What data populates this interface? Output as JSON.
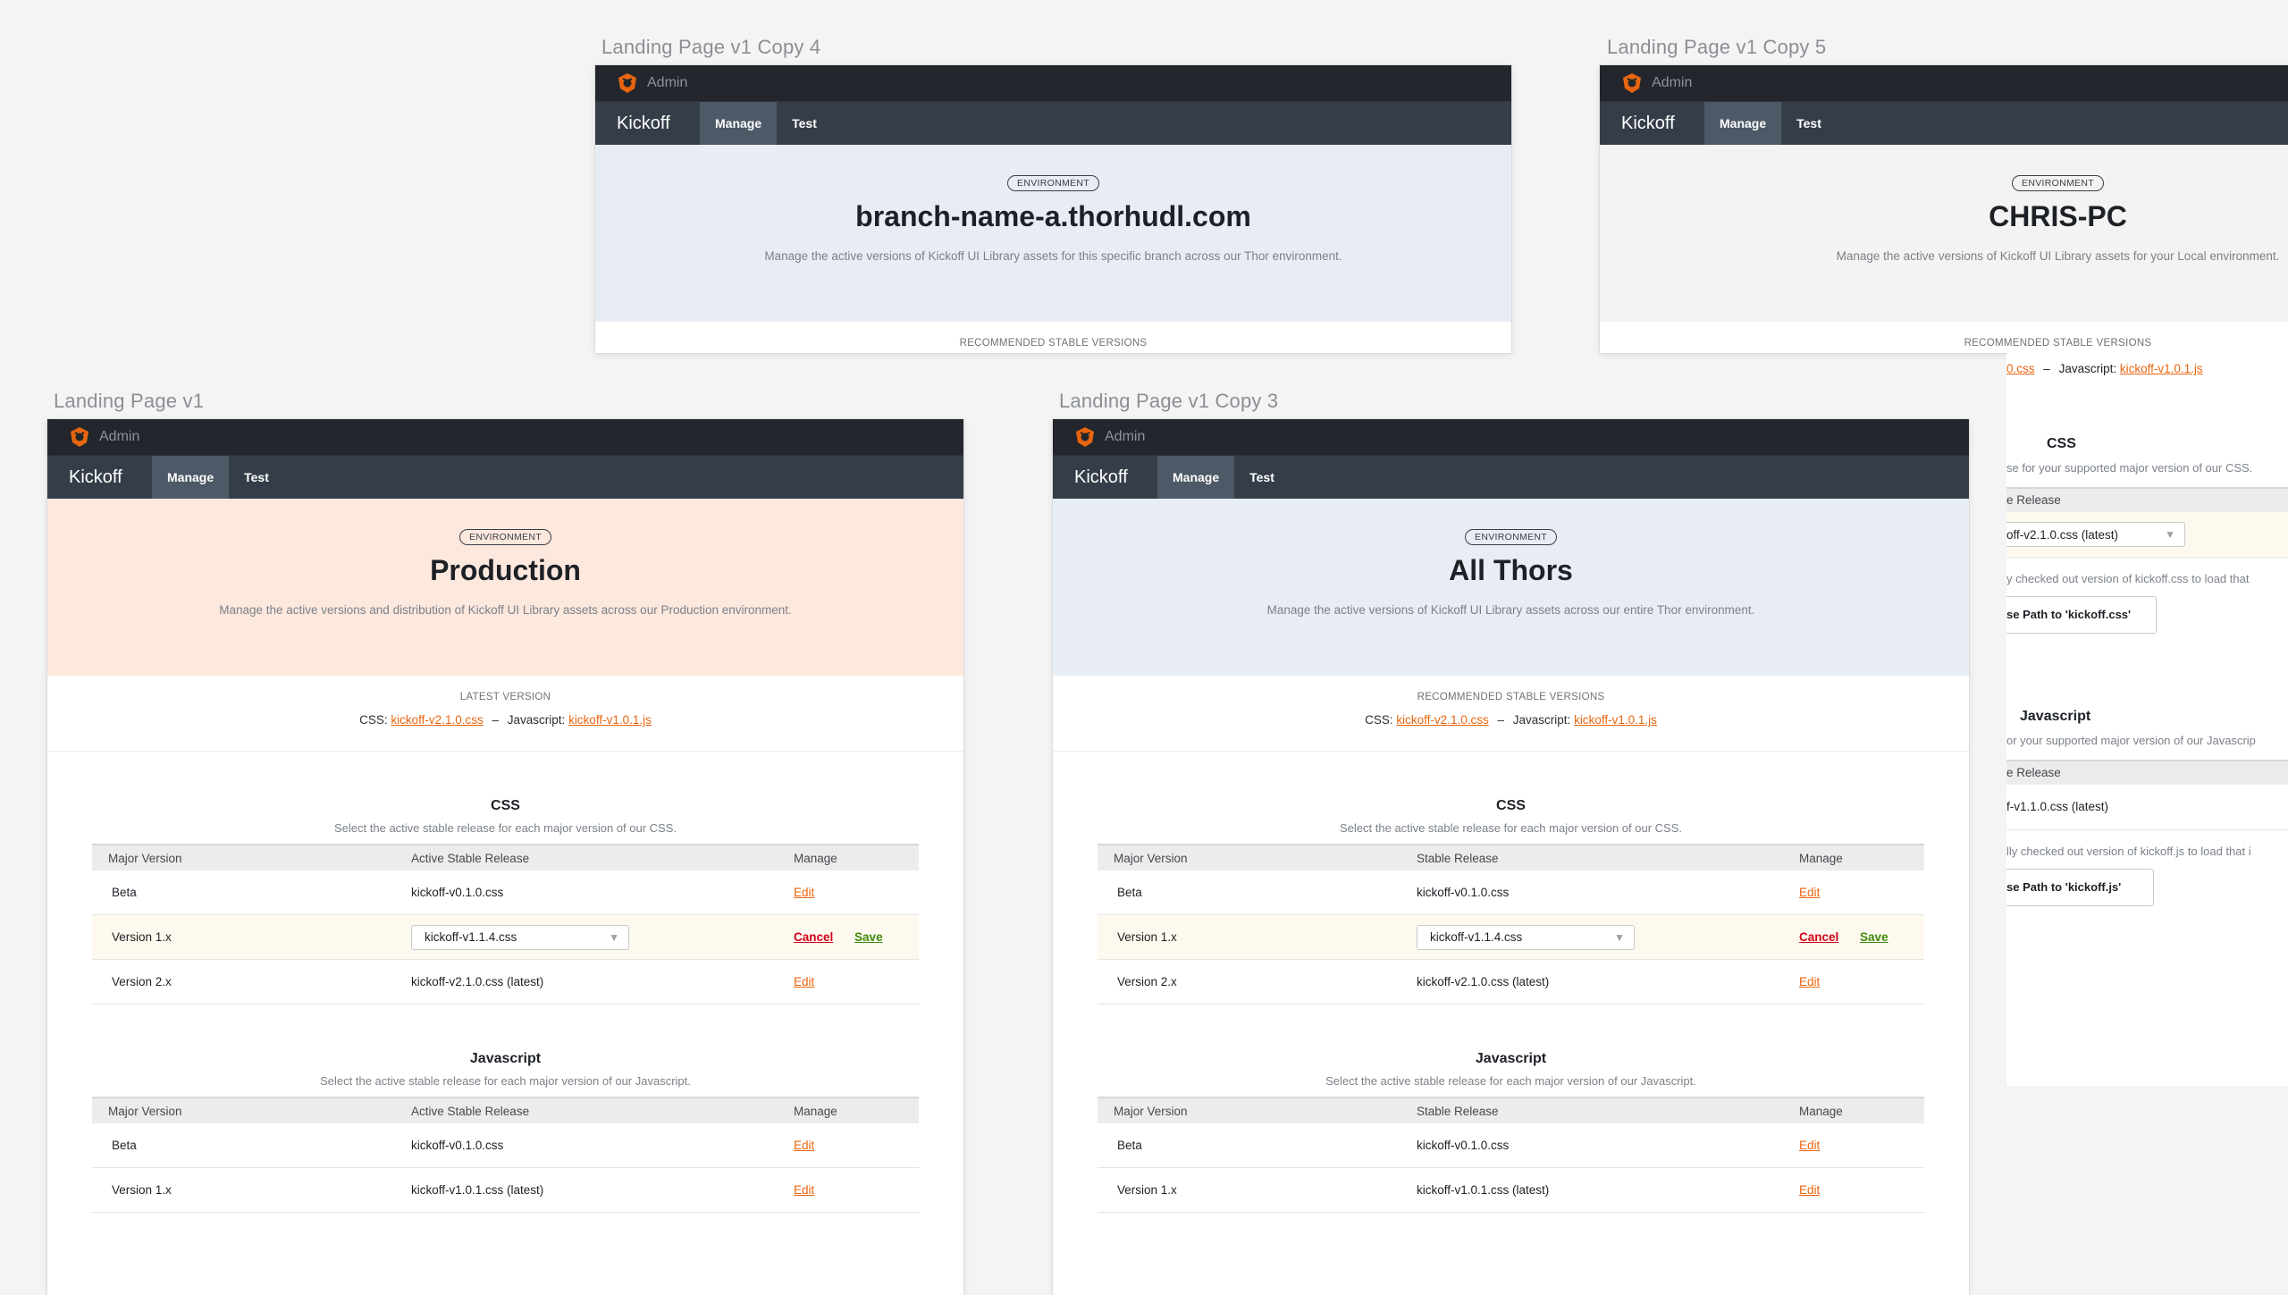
{
  "labels": {
    "copy4": "Landing Page v1 Copy 4",
    "copy5": "Landing Page v1 Copy 5",
    "v1": "Landing Page v1",
    "copy3": "Landing Page v1 Copy 3"
  },
  "common": {
    "admin": "Admin",
    "brand": "Kickoff",
    "tab_manage": "Manage",
    "tab_test": "Test",
    "env_badge": "ENVIRONMENT",
    "css_label": "CSS:",
    "js_label": "Javascript:",
    "dash": "–",
    "css_link": "kickoff-v2.1.0.css",
    "js_link": "kickoff-v1.0.1.js",
    "edit": "Edit",
    "cancel": "Cancel",
    "save": "Save"
  },
  "copy4": {
    "title": "branch-name-a.thorhudl.com",
    "sub": "Manage the active versions of Kickoff UI Library assets for this specific branch across our Thor environment.",
    "versions_title": "RECOMMENDED STABLE VERSIONS"
  },
  "copy5": {
    "title": "CHRIS-PC",
    "sub": "Manage the active versions of Kickoff UI Library assets for your Local environment.",
    "versions_title": "RECOMMENDED STABLE VERSIONS",
    "versions_css_partial": "0.css",
    "css_title": "CSS",
    "css_sub": "se for your supported major version of our CSS.",
    "css_col": "e Release",
    "css_select": "off-v2.1.0.css (latest)",
    "css_note": "y checked out version of kickoff.css to load that",
    "css_button": "se Path to 'kickoff.css'",
    "js_title": "Javascript",
    "js_sub": "or your supported major version of our Javascrip",
    "js_col": "e Release",
    "js_value": "f-v1.1.0.css (latest)",
    "js_note": "lly checked out version of kickoff.js to load that i",
    "js_button": "se Path to 'kickoff.js'"
  },
  "v1": {
    "title": "Production",
    "sub": "Manage the active versions and distribution of Kickoff UI Library assets across our Production environment.",
    "versions_title": "LATEST VERSION",
    "col1": "Major Version",
    "col2": "Active Stable Release",
    "col3": "Manage"
  },
  "copy3": {
    "title": "All Thors",
    "sub": "Manage the active versions of Kickoff UI Library assets across our entire Thor environment.",
    "versions_title": "RECOMMENDED STABLE VERSIONS",
    "col1": "Major Version",
    "col2": "Stable Release",
    "col3": "Manage"
  },
  "css_section": {
    "title": "CSS",
    "sub": "Select the active stable release for each major version of our CSS.",
    "rows": [
      {
        "version": "Beta",
        "release": "kickoff-v0.1.0.css"
      },
      {
        "version": "Version 1.x",
        "release": "kickoff-v1.1.4.css"
      },
      {
        "version": "Version 2.x",
        "release": "kickoff-v2.1.0.css (latest)"
      }
    ]
  },
  "js_section": {
    "title": "Javascript",
    "sub": "Select the active stable release for each major version of our Javascript.",
    "rows": [
      {
        "version": "Beta",
        "release": "kickoff-v0.1.0.css"
      },
      {
        "version": "Version 1.x",
        "release": "kickoff-v1.0.1.css (latest)"
      }
    ]
  },
  "colors": {
    "canvas": "#f4f4f5",
    "topbar": "#23272d",
    "navbar": "#353e48",
    "accent": "#e8650f",
    "hero_production": "#fde8de",
    "hero_thor": "#e8edf5",
    "hero_local": "#f3f3f3"
  }
}
